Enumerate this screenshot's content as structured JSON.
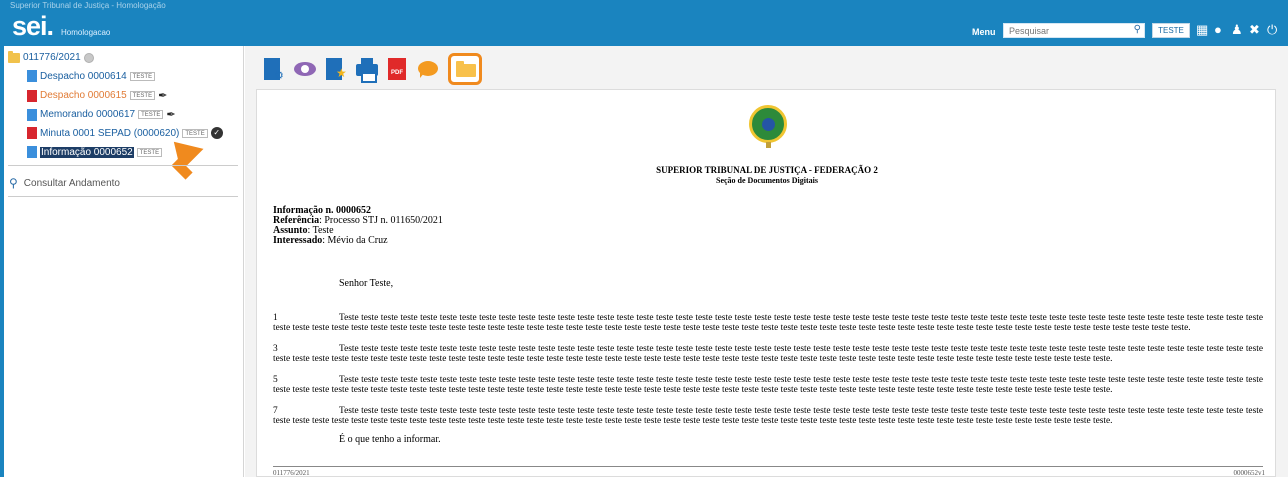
{
  "header": {
    "topline": "Superior Tribunal de Justiça - Homologação",
    "logo": "sei.",
    "logo_sub": "Homologacao",
    "menu_label": "Menu",
    "search_placeholder": "Pesquisar",
    "unit": "TESTE"
  },
  "icons": {
    "grid": "grid-icon",
    "info": "info-icon",
    "user": "user-icon",
    "tools": "tools-icon",
    "power": "power-icon"
  },
  "tree": {
    "process": "011776/2021",
    "documents": [
      {
        "label": "Despacho 0000614",
        "tag": "TESTE"
      },
      {
        "label": "Despacho 0000615",
        "tag": "TESTE"
      },
      {
        "label": "Memorando 0000617",
        "tag": "TESTE"
      },
      {
        "label": "Minuta 0001 SEPAD (0000620)",
        "tag": "TESTE"
      },
      {
        "label": "Informação 0000652",
        "tag": "TESTE"
      }
    ],
    "consult": "Consultar Andamento"
  },
  "document": {
    "org_title": "SUPERIOR TRIBUNAL DE JUSTIÇA - FEDERAÇÃO 2",
    "org_sub": "Seção de Documentos Digitais",
    "info_label": "Informação n. 0000652",
    "ref_label": "Referência",
    "ref_value": ": Processo STJ n. 011650/2021",
    "subject_label": "Assunto",
    "subject_value": ": Teste",
    "interested_label": "Interessado",
    "interested_value": ": Mévio da Cruz",
    "salutation": "Senhor Teste,",
    "paragraphs": [
      {
        "num": "1",
        "text": "Teste teste teste teste teste teste teste teste teste teste teste teste teste teste teste teste teste teste teste teste teste teste teste teste teste teste teste teste teste teste teste teste teste teste teste teste teste teste teste teste teste teste teste teste teste teste teste teste teste teste teste teste teste teste teste teste teste teste teste teste teste teste teste teste teste teste teste teste teste teste teste teste teste teste teste teste teste teste teste teste teste teste teste teste teste teste teste teste teste teste teste teste teste teste."
      },
      {
        "num": "3",
        "text": "Teste teste teste teste teste teste teste teste teste teste teste teste teste teste teste teste teste teste teste teste teste teste teste teste teste teste teste teste teste teste teste teste teste teste teste teste teste teste teste teste teste teste teste teste teste teste teste teste teste teste teste teste teste teste teste teste teste teste teste teste teste teste teste teste teste teste teste teste teste teste teste teste teste teste teste teste teste teste teste teste teste teste teste teste teste teste teste teste teste teste."
      },
      {
        "num": "5",
        "text": "Teste teste teste teste teste teste teste teste teste teste teste teste teste teste teste teste teste teste teste teste teste teste teste teste teste teste teste teste teste teste teste teste teste teste teste teste teste teste teste teste teste teste teste teste teste teste teste teste teste teste teste teste teste teste teste teste teste teste teste teste teste teste teste teste teste teste teste teste teste teste teste teste teste teste teste teste teste teste teste teste teste teste teste teste teste teste teste teste teste teste."
      },
      {
        "num": "7",
        "text": "Teste teste teste teste teste teste teste teste teste teste teste teste teste teste teste teste teste teste teste teste teste teste teste teste teste teste teste teste teste teste teste teste teste teste teste teste teste teste teste teste teste teste teste teste teste teste teste teste teste teste teste teste teste teste teste teste teste teste teste teste teste teste teste teste teste teste teste teste teste teste teste teste teste teste teste teste teste teste teste teste teste teste teste teste teste teste teste teste teste teste."
      }
    ],
    "closing": "É o que tenho a informar.",
    "footer_left": "011776/2021",
    "footer_right": "0000652v1"
  },
  "colors": {
    "header_bg": "#1a84bf",
    "highlight": "#f08a1e",
    "selected_bg": "#1d3d66"
  }
}
